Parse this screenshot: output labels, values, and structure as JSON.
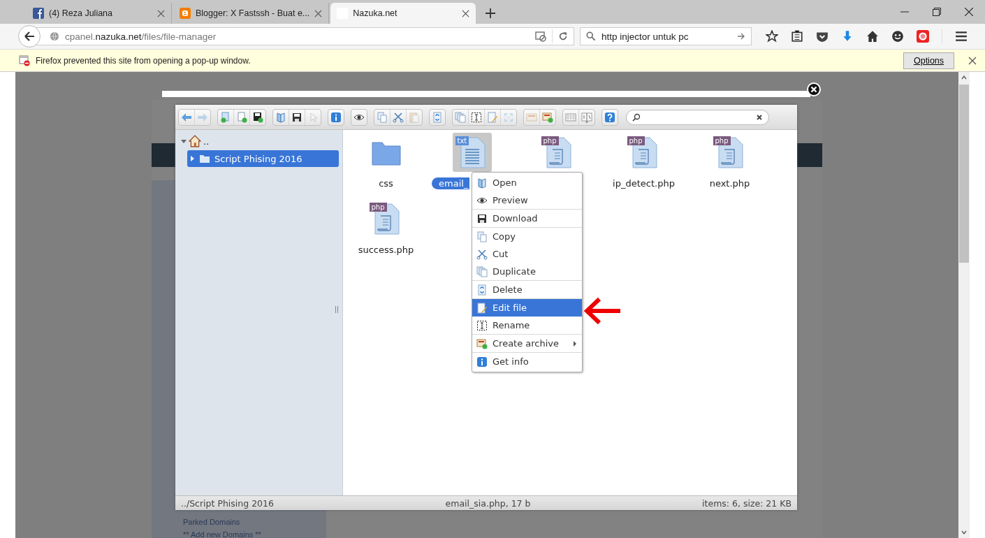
{
  "browser": {
    "tabs": [
      {
        "title": "(4) Reza Juliana",
        "kind": "facebook",
        "selected": false
      },
      {
        "title": "Blogger: X Fastssh - Buat e...",
        "kind": "blogger",
        "selected": false
      },
      {
        "title": "Nazuka.net",
        "kind": "blank",
        "selected": true
      }
    ],
    "url": {
      "prefix": "cpanel.",
      "domain": "nazuka.net",
      "path": "/files/file-manager"
    },
    "search": {
      "value": "http injector untuk pc"
    }
  },
  "notification": {
    "message": "Firefox prevented this site from opening a pop-up window.",
    "button": "Options"
  },
  "page_background": {
    "links": [
      "Parked Domains",
      "** Add new Domains **"
    ]
  },
  "file_manager": {
    "toolbar": [
      {
        "buttons": [
          {
            "kind": "back",
            "disabled": false
          },
          {
            "kind": "forward",
            "disabled": true
          }
        ]
      },
      {
        "buttons": [
          {
            "kind": "newfolder",
            "disabled": false
          },
          {
            "kind": "newfile",
            "disabled": false
          },
          {
            "kind": "upload",
            "disabled": false
          }
        ]
      },
      {
        "buttons": [
          {
            "kind": "open",
            "disabled": false
          },
          {
            "kind": "download",
            "disabled": false
          },
          {
            "kind": "select",
            "disabled": true
          }
        ]
      },
      {
        "buttons": [
          {
            "kind": "info",
            "disabled": false
          }
        ]
      },
      {
        "buttons": [
          {
            "kind": "view",
            "disabled": false
          }
        ]
      },
      {
        "buttons": [
          {
            "kind": "copy",
            "disabled": false
          },
          {
            "kind": "cut",
            "disabled": false
          },
          {
            "kind": "paste",
            "disabled": true
          }
        ]
      },
      {
        "buttons": [
          {
            "kind": "delete",
            "disabled": false
          }
        ]
      },
      {
        "buttons": [
          {
            "kind": "duplicate",
            "disabled": false
          },
          {
            "kind": "rename",
            "disabled": false
          },
          {
            "kind": "edit",
            "disabled": false
          },
          {
            "kind": "resize",
            "disabled": true
          }
        ]
      },
      {
        "buttons": [
          {
            "kind": "extract",
            "disabled": true
          },
          {
            "kind": "archive",
            "disabled": false
          }
        ]
      },
      {
        "buttons": [
          {
            "kind": "grid",
            "disabled": false
          },
          {
            "kind": "sort",
            "disabled": false
          }
        ]
      },
      {
        "buttons": [
          {
            "kind": "help",
            "disabled": false
          }
        ]
      }
    ],
    "tree": {
      "label": "..",
      "expanded": true,
      "children": [
        {
          "label": "Script Phising 2016",
          "selected": true,
          "expanded": false
        }
      ]
    },
    "files": [
      {
        "name": "css",
        "kind": "folder",
        "selected": false
      },
      {
        "name": "email_",
        "kind": "text",
        "badge": "txt",
        "selected": true
      },
      {
        "kind": "script",
        "badge": "php",
        "selected": false
      },
      {
        "name": "ip_detect.php",
        "kind": "script",
        "badge": "php",
        "selected": false
      },
      {
        "name": "next.php",
        "kind": "script",
        "badge": "php",
        "selected": false
      },
      {
        "name": "success.php",
        "kind": "script",
        "badge": "php",
        "selected": false
      }
    ],
    "context_menu": {
      "groups": [
        {
          "items": [
            {
              "label": "Open",
              "kind": "open",
              "selected": false,
              "submenu": false
            },
            {
              "label": "Preview",
              "kind": "view",
              "selected": false,
              "submenu": false
            }
          ]
        },
        {
          "items": [
            {
              "label": "Download",
              "kind": "download",
              "selected": false,
              "submenu": false
            }
          ]
        },
        {
          "items": [
            {
              "label": "Copy",
              "kind": "copy",
              "selected": false,
              "submenu": false
            },
            {
              "label": "Cut",
              "kind": "cut",
              "selected": false,
              "submenu": false
            },
            {
              "label": "Duplicate",
              "kind": "duplicate",
              "selected": false,
              "submenu": false
            }
          ]
        },
        {
          "items": [
            {
              "label": "Delete",
              "kind": "delete",
              "selected": false,
              "submenu": false
            }
          ]
        },
        {
          "items": [
            {
              "label": "Edit file",
              "kind": "edit",
              "selected": true,
              "submenu": false
            },
            {
              "label": "Rename",
              "kind": "rename",
              "selected": false,
              "submenu": false
            }
          ]
        },
        {
          "items": [
            {
              "label": "Create archive",
              "kind": "archive",
              "selected": false,
              "submenu": true
            }
          ]
        },
        {
          "items": [
            {
              "label": "Get info",
              "kind": "info",
              "selected": false,
              "submenu": false
            }
          ]
        }
      ]
    },
    "status_bar": {
      "path": "../Script Phising 2016",
      "selection": "email_sia.php, 17 b",
      "summary": "items: 6, size: 21 KB"
    }
  }
}
